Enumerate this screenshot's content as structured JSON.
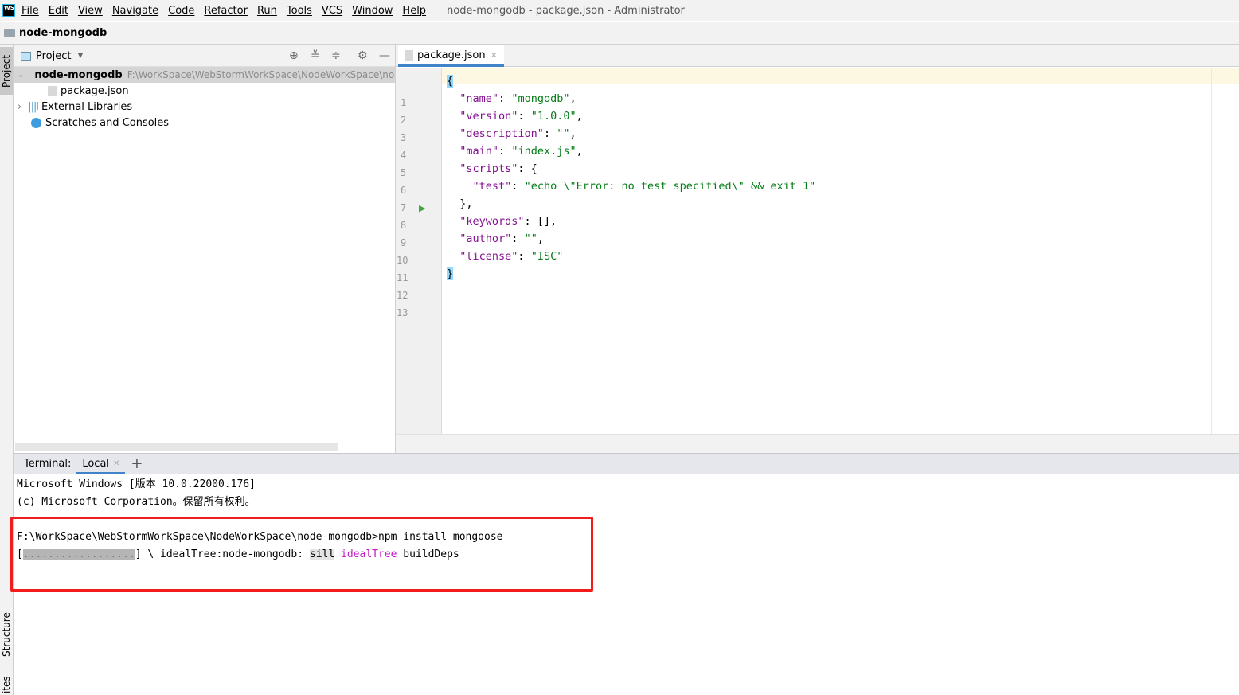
{
  "menubar": {
    "logo": "WS",
    "items": [
      "File",
      "Edit",
      "View",
      "Navigate",
      "Code",
      "Refactor",
      "Run",
      "Tools",
      "VCS",
      "Window",
      "Help"
    ],
    "title": "node-mongodb - package.json - Administrator"
  },
  "navbar": {
    "project": "node-mongodb"
  },
  "sidestrip": {
    "project": "Project",
    "structure": "Structure",
    "favorites": "ites"
  },
  "project_panel": {
    "title": "Project",
    "tree": [
      {
        "label": "node-mongodb",
        "path": "F:\\WorkSpace\\WebStormWorkSpace\\NodeWorkSpace\\node-mongodb"
      },
      {
        "label": "package.json"
      },
      {
        "label": "External Libraries"
      },
      {
        "label": "Scratches and Consoles"
      }
    ]
  },
  "editor": {
    "tab": "package.json",
    "lines": [
      [
        [
          "{",
          "brace"
        ]
      ],
      [
        [
          "  ",
          "p"
        ],
        [
          "\"name\"",
          "k"
        ],
        [
          ": ",
          "p"
        ],
        [
          "\"mongodb\"",
          "s"
        ],
        [
          ",",
          "p"
        ]
      ],
      [
        [
          "  ",
          "p"
        ],
        [
          "\"version\"",
          "k"
        ],
        [
          ": ",
          "p"
        ],
        [
          "\"1.0.0\"",
          "s"
        ],
        [
          ",",
          "p"
        ]
      ],
      [
        [
          "  ",
          "p"
        ],
        [
          "\"description\"",
          "k"
        ],
        [
          ": ",
          "p"
        ],
        [
          "\"\"",
          "s"
        ],
        [
          ",",
          "p"
        ]
      ],
      [
        [
          "  ",
          "p"
        ],
        [
          "\"main\"",
          "k"
        ],
        [
          ": ",
          "p"
        ],
        [
          "\"index.js\"",
          "s"
        ],
        [
          ",",
          "p"
        ]
      ],
      [
        [
          "  ",
          "p"
        ],
        [
          "\"scripts\"",
          "k"
        ],
        [
          ": {",
          "p"
        ]
      ],
      [
        [
          "    ",
          "p"
        ],
        [
          "\"test\"",
          "k"
        ],
        [
          ": ",
          "p"
        ],
        [
          "\"echo \\\"Error: no test specified\\\" && exit 1\"",
          "s"
        ]
      ],
      [
        [
          "  },",
          "p"
        ]
      ],
      [
        [
          "  ",
          "p"
        ],
        [
          "\"keywords\"",
          "k"
        ],
        [
          ": [],",
          "p"
        ]
      ],
      [
        [
          "  ",
          "p"
        ],
        [
          "\"author\"",
          "k"
        ],
        [
          ": ",
          "p"
        ],
        [
          "\"\"",
          "s"
        ],
        [
          ",",
          "p"
        ]
      ],
      [
        [
          "  ",
          "p"
        ],
        [
          "\"license\"",
          "k"
        ],
        [
          ": ",
          "p"
        ],
        [
          "\"ISC\"",
          "s"
        ]
      ],
      [
        [
          "}",
          "brace"
        ]
      ],
      []
    ]
  },
  "terminal": {
    "label": "Terminal:",
    "tab": "Local",
    "add": "+",
    "line1": "Microsoft Windows [版本 10.0.22000.176]",
    "line2": "(c) Microsoft Corporation。保留所有权利。",
    "command": "F:\\WorkSpace\\WebStormWorkSpace\\NodeWorkSpace\\node-mongodb>npm install mongoose",
    "progress_open": "[",
    "progress_bar": "..................",
    "progress_close": "] \\ idealTree:node-mongodb: ",
    "sill": "sill",
    "ideal": "idealTree",
    "build": " buildDeps"
  }
}
